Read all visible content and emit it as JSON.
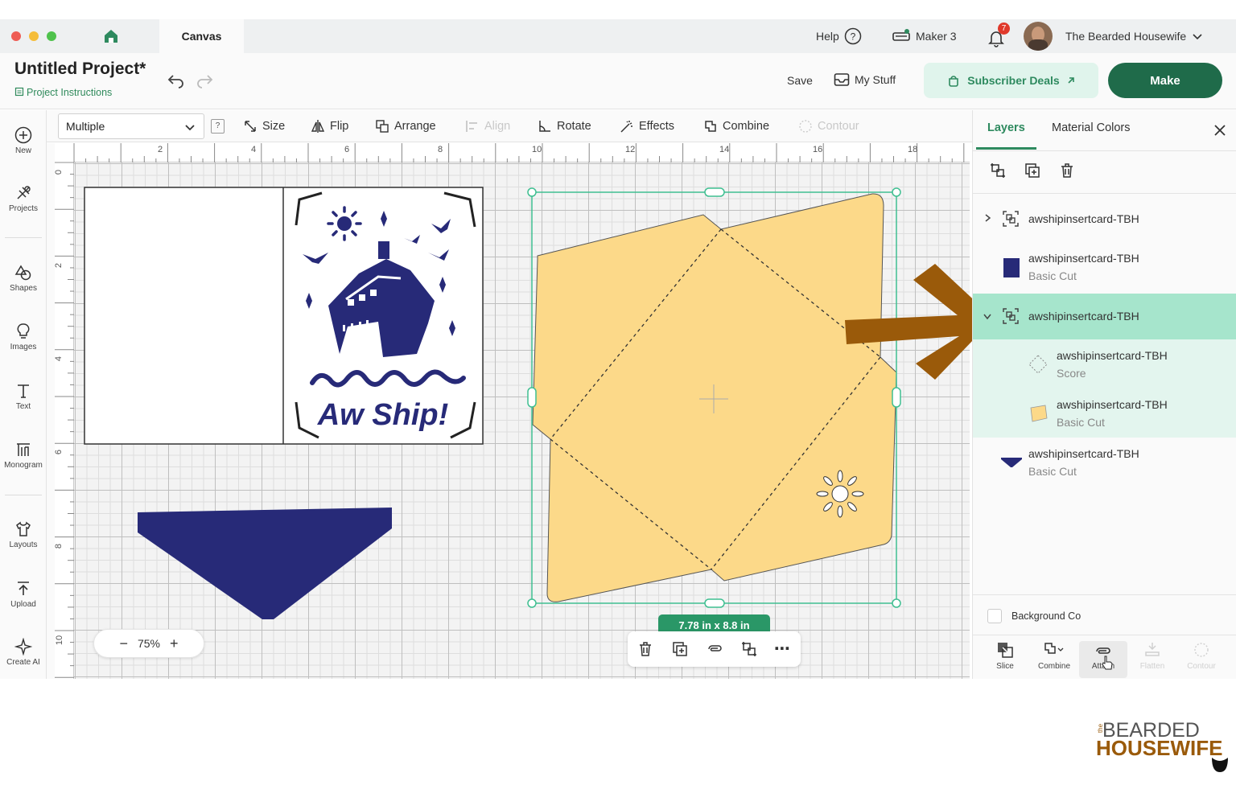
{
  "window": {
    "tab": "Canvas"
  },
  "topbar": {
    "help": "Help",
    "machine": "Maker 3",
    "notif_count": "7",
    "user": "The Bearded Housewife"
  },
  "project": {
    "title": "Untitled Project*",
    "instructions": "Project Instructions"
  },
  "header": {
    "save": "Save",
    "my_stuff": "My Stuff",
    "subscriber_deals": "Subscriber Deals",
    "make": "Make"
  },
  "sidebar": {
    "items": [
      {
        "label": "New",
        "icon": "plus-circle-icon"
      },
      {
        "label": "Projects",
        "icon": "projects-icon"
      },
      {
        "label": "Shapes",
        "icon": "shapes-icon"
      },
      {
        "label": "Images",
        "icon": "bulb-icon"
      },
      {
        "label": "Text",
        "icon": "text-icon"
      },
      {
        "label": "Monogram",
        "icon": "monogram-icon"
      },
      {
        "label": "Layouts",
        "icon": "shirt-icon"
      },
      {
        "label": "Upload",
        "icon": "upload-icon"
      },
      {
        "label": "Create AI",
        "icon": "sparkle-icon"
      }
    ]
  },
  "toolbar": {
    "selection": "Multiple",
    "help_badge": "?",
    "size": "Size",
    "flip": "Flip",
    "arrange": "Arrange",
    "align": "Align",
    "rotate": "Rotate",
    "effects": "Effects",
    "combine": "Combine",
    "contour": "Contour"
  },
  "ruler": {
    "h": [
      "2",
      "4",
      "6",
      "8",
      "10",
      "12",
      "14",
      "16",
      "18"
    ],
    "v": [
      "0",
      "2",
      "4",
      "6",
      "8",
      "10"
    ]
  },
  "canvas": {
    "card_text": "Aw Ship!",
    "dimensions": "7.78 in x 8.8 in",
    "zoom": "75%",
    "colors": {
      "navy": "#272a78",
      "yellow": "#fcd989",
      "selection": "#3fbf91",
      "arrow": "#9a5a0a"
    }
  },
  "panel": {
    "tabs": {
      "layers": "Layers",
      "material_colors": "Material Colors"
    },
    "layers": [
      {
        "name": "awshipinsertcard-TBH",
        "type": "",
        "kind": "group"
      },
      {
        "name": "awshipinsertcard-TBH",
        "type": "Basic Cut",
        "kind": "navy-square"
      },
      {
        "name": "awshipinsertcard-TBH",
        "type": "",
        "kind": "group-selected"
      },
      {
        "name": "awshipinsertcard-TBH",
        "type": "Score",
        "kind": "score"
      },
      {
        "name": "awshipinsertcard-TBH",
        "type": "Basic Cut",
        "kind": "yellow-envelope"
      },
      {
        "name": "awshipinsertcard-TBH",
        "type": "Basic Cut",
        "kind": "navy-triangle"
      }
    ],
    "background_label": "Background Co",
    "bottom": [
      "Slice",
      "Combine",
      "Attach",
      "Flatten",
      "Contour"
    ]
  },
  "watermark": {
    "line1": "BEARDED",
    "line2": "HOUSEWIFE",
    "small": "the"
  }
}
